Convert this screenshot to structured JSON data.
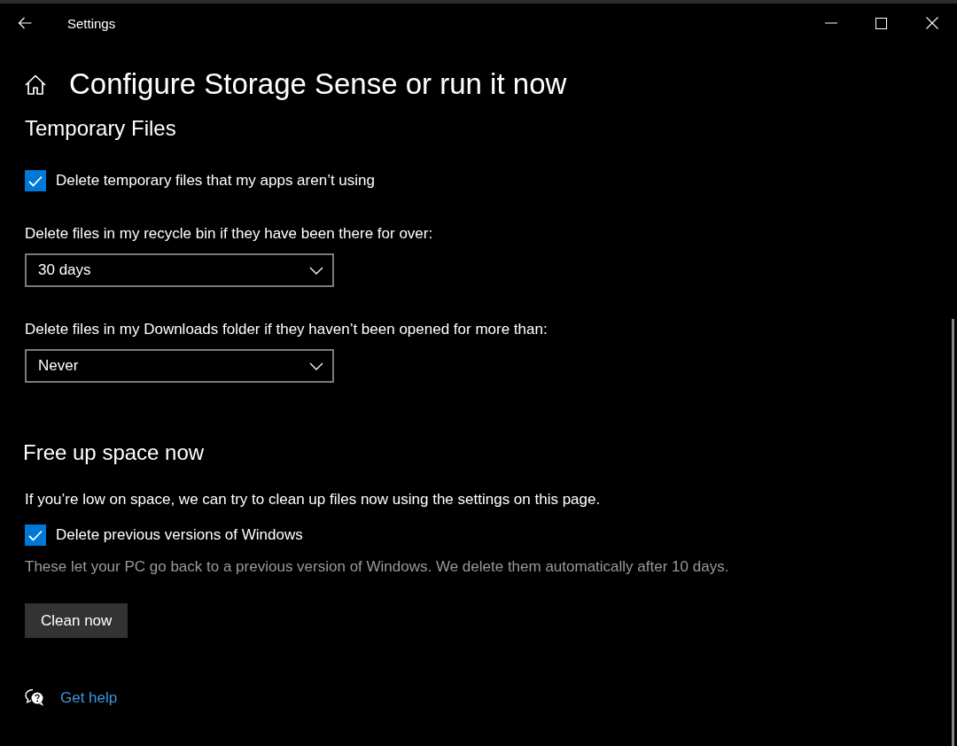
{
  "window": {
    "title": "Settings"
  },
  "page": {
    "title": "Configure Storage Sense or run it now"
  },
  "sections": [
    {
      "heading": "Temporary Files",
      "items": [
        {
          "kind": "checkbox",
          "label": "Delete temporary files that my apps aren’t using",
          "checked": true
        },
        {
          "kind": "dropdown",
          "label": "Delete files in my recycle bin if they have been there for over:",
          "value": "30 days"
        },
        {
          "kind": "dropdown",
          "label": "Delete files in my Downloads folder if they haven’t been opened for more than:",
          "value": "Never"
        }
      ]
    },
    {
      "heading": "Free up space now",
      "items": [
        {
          "kind": "text",
          "text": "If you’re low on space, we can try to clean up files now using the settings on this page."
        },
        {
          "kind": "checkbox",
          "label": "Delete previous versions of Windows",
          "checked": true
        },
        {
          "kind": "note",
          "text": "These let your PC go back to a previous version of Windows. We delete them automatically after 10 days."
        },
        {
          "kind": "button",
          "label": "Clean now"
        }
      ]
    }
  ],
  "help_link": {
    "label": "Get help"
  }
}
